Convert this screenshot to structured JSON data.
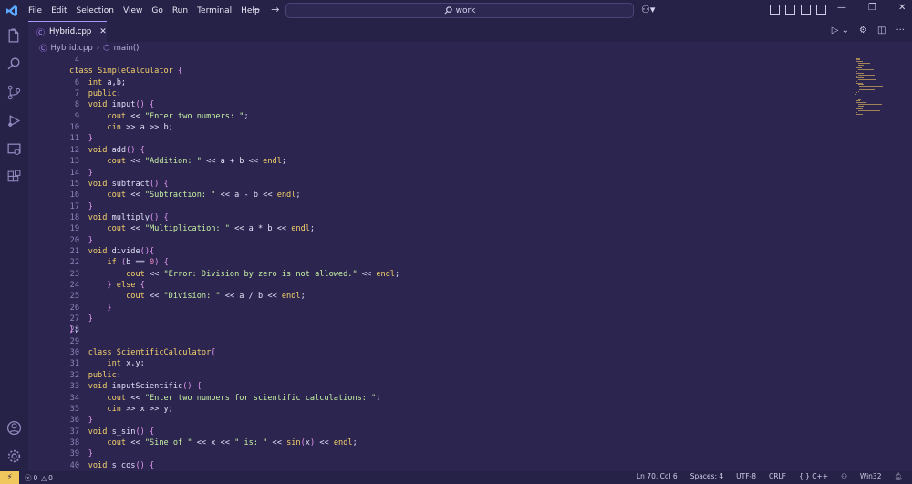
{
  "menu": [
    "File",
    "Edit",
    "Selection",
    "View",
    "Go",
    "Run",
    "Terminal",
    "Help"
  ],
  "search": {
    "text": "work"
  },
  "tab": {
    "name": "Hybrid.cpp",
    "close": "✕"
  },
  "breadcrumb": {
    "file": "Hybrid.cpp",
    "symbol": "main()"
  },
  "lines": [
    {
      "n": "4",
      "code": ""
    },
    {
      "n": "5",
      "code": "class SimpleCalculator {"
    },
    {
      "n": "6",
      "code": "    int a,b;"
    },
    {
      "n": "7",
      "code": "    public:"
    },
    {
      "n": "8",
      "code": "    void input() {"
    },
    {
      "n": "9",
      "code": "        cout << \"Enter two numbers: \";"
    },
    {
      "n": "10",
      "code": "        cin >> a >> b;"
    },
    {
      "n": "11",
      "code": "    }"
    },
    {
      "n": "12",
      "code": "    void add() {"
    },
    {
      "n": "13",
      "code": "        cout << \"Addition: \" << a + b << endl;"
    },
    {
      "n": "14",
      "code": "    }"
    },
    {
      "n": "15",
      "code": "    void subtract() {"
    },
    {
      "n": "16",
      "code": "        cout << \"Subtraction: \" << a - b << endl;"
    },
    {
      "n": "17",
      "code": "    }"
    },
    {
      "n": "18",
      "code": "    void multiply() {"
    },
    {
      "n": "19",
      "code": "        cout << \"Multiplication: \" << a * b << endl;"
    },
    {
      "n": "20",
      "code": "    }"
    },
    {
      "n": "21",
      "code": "    void divide(){"
    },
    {
      "n": "22",
      "code": "        if (b == 0) {"
    },
    {
      "n": "23",
      "code": "            cout << \"Error: Division by zero is not allowed.\" << endl;"
    },
    {
      "n": "24",
      "code": "        } else {"
    },
    {
      "n": "25",
      "code": "            cout << \"Division: \" << a / b << endl;"
    },
    {
      "n": "26",
      "code": "        }"
    },
    {
      "n": "27",
      "code": "    }"
    },
    {
      "n": "28",
      "code": "};"
    },
    {
      "n": "29",
      "code": ""
    },
    {
      "n": "30",
      "code": "    class ScientificCalculator{"
    },
    {
      "n": "31",
      "code": "        int x,y;"
    },
    {
      "n": "32",
      "code": "    public:"
    },
    {
      "n": "33",
      "code": "    void inputScientific() {"
    },
    {
      "n": "34",
      "code": "        cout << \"Enter two numbers for scientific calculations: \";"
    },
    {
      "n": "35",
      "code": "        cin >> x >> y;"
    },
    {
      "n": "36",
      "code": "    }"
    },
    {
      "n": "37",
      "code": "    void s_sin() {"
    },
    {
      "n": "38",
      "code": "        cout << \"Sine of \" << x << \" is: \" << sin(x) << endl;"
    },
    {
      "n": "39",
      "code": "    }"
    },
    {
      "n": "40",
      "code": "    void s_cos() {"
    }
  ],
  "status": {
    "errors": "0",
    "warnings": "0",
    "position": "Ln 70, Col 6",
    "spaces": "Spaces: 4",
    "encoding": "UTF-8",
    "eol": "CRLF",
    "language": "{ } C++",
    "platform": "Win32"
  },
  "colors": {
    "background": "#2b2550",
    "chrome": "#262146",
    "keyword": "#f6d26b",
    "string": "#c8f1a3",
    "accent": "#a29bff",
    "remote": "#f0c75d"
  }
}
